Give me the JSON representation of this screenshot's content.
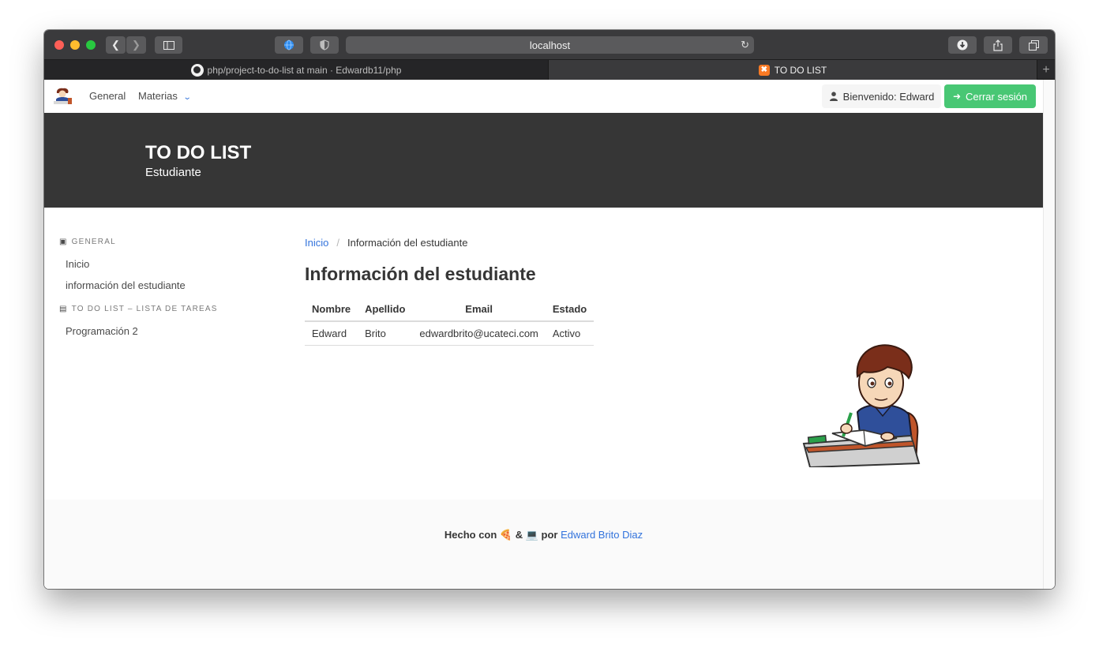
{
  "browser": {
    "url": "localhost",
    "tabs": [
      {
        "label": "php/project-to-do-list at main · Edwardb11/php",
        "active": false
      },
      {
        "label": "TO DO LIST",
        "active": true
      }
    ]
  },
  "navbar": {
    "general_label": "General",
    "materias_label": "Materias",
    "welcome_label": "Bienvenido: Edward",
    "logout_label": "Cerrar sesión"
  },
  "hero": {
    "title": "TO DO LIST",
    "subtitle": "Estudiante"
  },
  "menu": {
    "section1_label": "GENERAL",
    "section1_items": [
      "Inicio",
      "información del estudiante"
    ],
    "section2_label": "TO DO LIST – LISTA DE TAREAS",
    "section2_items": [
      "Programación 2"
    ]
  },
  "breadcrumb": {
    "home": "Inicio",
    "separator": "/",
    "current": "Información del estudiante"
  },
  "content": {
    "title": "Información del estudiante",
    "table": {
      "headers": [
        "Nombre",
        "Apellido",
        "Email",
        "Estado"
      ],
      "rows": [
        [
          "Edward",
          "Brito",
          "edwardbrito@ucateci.com",
          "Activo"
        ]
      ]
    }
  },
  "footer": {
    "made_with": "Hecho con 🍕 & 💻 por",
    "author": "Edward Brito Diaz"
  },
  "colors": {
    "hero_bg": "#363636",
    "link": "#3273dc",
    "success": "#48c774"
  }
}
